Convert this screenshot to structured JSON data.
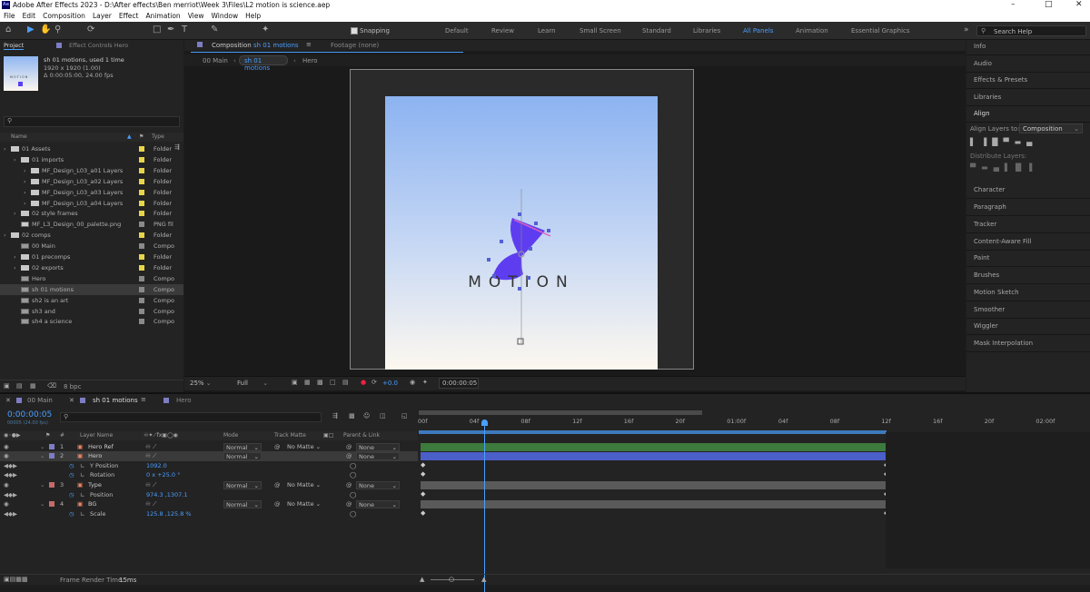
{
  "window": {
    "title": "Adobe After Effects 2023 - D:\\After effects\\Ben merriot\\Week 3\\Files\\L2 motion is science.aep",
    "app_icon": "Ae"
  },
  "menu": [
    "File",
    "Edit",
    "Composition",
    "Layer",
    "Effect",
    "Animation",
    "View",
    "Window",
    "Help"
  ],
  "toolbar": {
    "snapping_label": "Snapping",
    "search_placeholder": "Search Help",
    "workspaces": [
      "Default",
      "Review",
      "Learn",
      "Small Screen",
      "Standard",
      "Libraries",
      "All Panels",
      "Animation",
      "Essential Graphics"
    ],
    "active_workspace": "All Panels"
  },
  "project_panel": {
    "tab": "Project",
    "effect_controls_tab": "Effect Controls Hero",
    "item_name": "sh 01 motions",
    "item_used": ", used 1 time",
    "item_res": "1920 x 1920 (1.00)",
    "item_dur": "Δ 0:00:05:00, 24.00 fps",
    "thumb_text": "MOTION",
    "col_name": "Name",
    "col_type": "Type",
    "items": [
      {
        "name": "01 Assets",
        "type": "Folder",
        "indent": 0,
        "kind": "folder",
        "color": "#e8d44a"
      },
      {
        "name": "01 imports",
        "type": "Folder",
        "indent": 1,
        "kind": "folder",
        "color": "#e8d44a"
      },
      {
        "name": "MF_Design_L03_a01 Layers",
        "type": "Folder",
        "indent": 2,
        "kind": "folder",
        "color": "#e8d44a"
      },
      {
        "name": "MF_Design_L03_a02 Layers",
        "type": "Folder",
        "indent": 2,
        "kind": "folder",
        "color": "#e8d44a"
      },
      {
        "name": "MF_Design_L03_a03 Layers",
        "type": "Folder",
        "indent": 2,
        "kind": "folder",
        "color": "#e8d44a"
      },
      {
        "name": "MF_Design_L03_a04 Layers",
        "type": "Folder",
        "indent": 2,
        "kind": "folder",
        "color": "#e8d44a"
      },
      {
        "name": "02 style frames",
        "type": "Folder",
        "indent": 1,
        "kind": "folder",
        "color": "#e8d44a"
      },
      {
        "name": "MF_L3_Design_00_palette.png",
        "type": "PNG fil",
        "indent": 1,
        "kind": "file",
        "color": "#8a8a8a"
      },
      {
        "name": "02 comps",
        "type": "Folder",
        "indent": 0,
        "kind": "folder",
        "color": "#e8d44a"
      },
      {
        "name": "00 Main",
        "type": "Compo",
        "indent": 1,
        "kind": "comp",
        "color": "#8a8a8a"
      },
      {
        "name": "01 precomps",
        "type": "Folder",
        "indent": 1,
        "kind": "folder",
        "color": "#e8d44a"
      },
      {
        "name": "02 exports",
        "type": "Folder",
        "indent": 1,
        "kind": "folder",
        "color": "#e8d44a"
      },
      {
        "name": "Hero",
        "type": "Compo",
        "indent": 1,
        "kind": "comp",
        "color": "#8a8a8a"
      },
      {
        "name": "sh 01 motions",
        "type": "Compo",
        "indent": 1,
        "kind": "comp",
        "color": "#8a8a8a",
        "selected": true
      },
      {
        "name": "sh2 is an art",
        "type": "Compo",
        "indent": 1,
        "kind": "comp",
        "color": "#8a8a8a"
      },
      {
        "name": "sh3 and",
        "type": "Compo",
        "indent": 1,
        "kind": "comp",
        "color": "#8a8a8a"
      },
      {
        "name": "sh4 a science",
        "type": "Compo",
        "indent": 1,
        "kind": "comp",
        "color": "#8a8a8a"
      }
    ],
    "bpc": "8 bpc"
  },
  "viewer": {
    "comp_tab": "Composition",
    "comp_name": "sh 01 motions",
    "footage_tab": "Footage (none)",
    "breadcrumbs": [
      "00 Main",
      "sh 01 motions",
      "Hero"
    ],
    "canvas_text": "MOTION",
    "zoom": "25%",
    "resolution": "Full",
    "exposure": "+0.0",
    "timecode": "0:00:00:05"
  },
  "right_panels": [
    "Info",
    "Audio",
    "Effects & Presets",
    "Libraries",
    "Align",
    "Character",
    "Paragraph",
    "Tracker",
    "Content-Aware Fill",
    "Paint",
    "Brushes",
    "Motion Sketch",
    "Smoother",
    "Wiggler",
    "Mask Interpolation"
  ],
  "align": {
    "align_layers_to": "Align Layers to:",
    "target": "Composition",
    "distribute": "Distribute Layers:"
  },
  "timeline": {
    "tabs": [
      "00 Main",
      "sh 01 motions",
      "Hero"
    ],
    "timecode": "0:00:00:05",
    "fps_sub": "00005 (24.00 fps)",
    "col_headers": {
      "num": "#",
      "layer_name": "Layer Name",
      "mode": "Mode",
      "track_matte": "Track Matte",
      "parent": "Parent & Link"
    },
    "ruler": [
      "00f",
      "04f",
      "08f",
      "12f",
      "16f",
      "20f",
      "01:00f",
      "04f",
      "08f",
      "12f",
      "16f",
      "20f",
      "02:00f"
    ],
    "layers": [
      {
        "num": "1",
        "name": "Hero Ref",
        "kind": "layer",
        "mode": "Normal",
        "matte": "No Matte",
        "parent": "None",
        "color": "#7d7dc4"
      },
      {
        "num": "2",
        "name": "Hero",
        "kind": "layer",
        "mode": "Normal",
        "matte": "",
        "parent": "None",
        "color": "#7d7dc4",
        "selected": true
      },
      {
        "num": "",
        "name": "Y Position",
        "kind": "prop",
        "value": "1092.0"
      },
      {
        "num": "",
        "name": "Rotation",
        "kind": "prop",
        "value": "0 x +25.0 °"
      },
      {
        "num": "3",
        "name": "Type",
        "kind": "layer",
        "mode": "Normal",
        "matte": "No Matte",
        "parent": "None",
        "color": "#c46a6a"
      },
      {
        "num": "",
        "name": "Position",
        "kind": "prop",
        "value": "974.3 ,1307.1"
      },
      {
        "num": "4",
        "name": "BG",
        "kind": "layer",
        "mode": "Normal",
        "matte": "No Matte",
        "parent": "None",
        "color": "#c46a6a"
      },
      {
        "num": "",
        "name": "Scale",
        "kind": "prop",
        "value": "125.8 ,125.8 %"
      }
    ],
    "frame_render": "Frame Render Time:",
    "frame_render_value": "15ms"
  }
}
